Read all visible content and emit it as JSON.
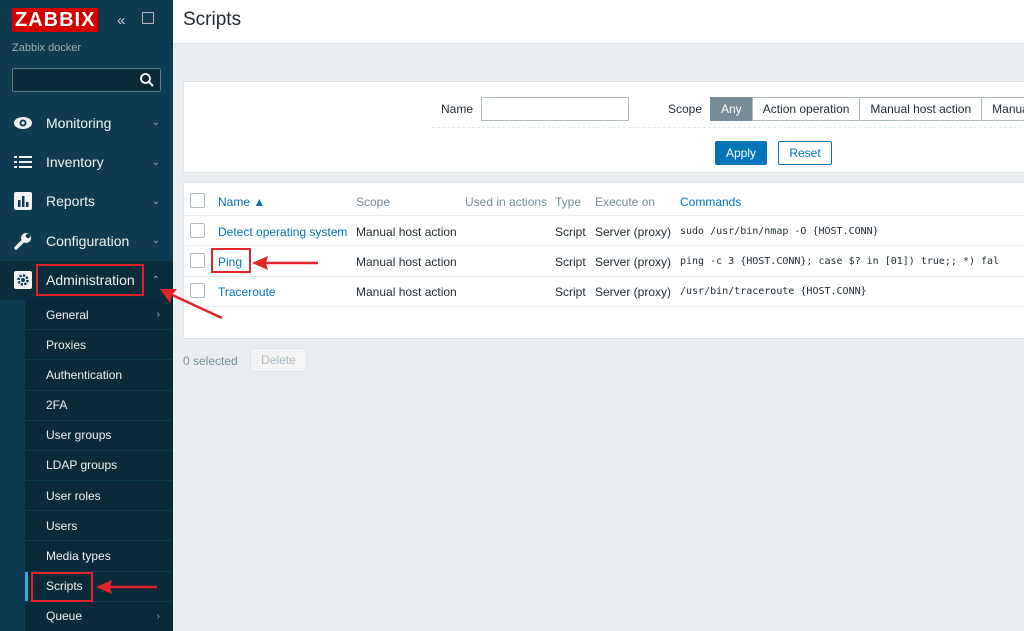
{
  "brand": {
    "logo": "ZABBIX",
    "server_name": "Zabbix docker"
  },
  "sidebar": {
    "collapse_icon": "double-chevron-left-icon",
    "kiosk_icon": "expand-icon",
    "menu": [
      {
        "label": "Monitoring",
        "icon": "eye-icon"
      },
      {
        "label": "Inventory",
        "icon": "list-icon"
      },
      {
        "label": "Reports",
        "icon": "bar-chart-icon"
      },
      {
        "label": "Configuration",
        "icon": "wrench-icon"
      },
      {
        "label": "Administration",
        "icon": "gear-icon"
      }
    ],
    "admin_submenu": [
      "General",
      "Proxies",
      "Authentication",
      "2FA",
      "User groups",
      "LDAP groups",
      "User roles",
      "Users",
      "Media types",
      "Scripts",
      "Queue"
    ]
  },
  "header": {
    "title": "Scripts"
  },
  "filter": {
    "name_label": "Name",
    "name_value": "",
    "scope_label": "Scope",
    "scope_options": [
      "Any",
      "Action operation",
      "Manual host action",
      "Manua"
    ],
    "scope_selected": "Any",
    "apply": "Apply",
    "reset": "Reset"
  },
  "table": {
    "columns": [
      "Name ▲",
      "Scope",
      "Used in actions",
      "Type",
      "Execute on",
      "Commands"
    ],
    "rows": [
      {
        "name": "Detect operating system",
        "scope": "Manual host action",
        "used": "",
        "type": "Script",
        "execute_on": "Server (proxy)",
        "command": "sudo /usr/bin/nmap -O {HOST.CONN}"
      },
      {
        "name": "Ping",
        "scope": "Manual host action",
        "used": "",
        "type": "Script",
        "execute_on": "Server (proxy)",
        "command": "ping -c 3 {HOST.CONN}; case $? in [01]) true;; *) fal"
      },
      {
        "name": "Traceroute",
        "scope": "Manual host action",
        "used": "",
        "type": "Script",
        "execute_on": "Server (proxy)",
        "command": "/usr/bin/traceroute {HOST.CONN}"
      }
    ]
  },
  "footer": {
    "selected": "0 selected",
    "delete": "Delete"
  },
  "colors": {
    "sidebar": "#0e3b50",
    "accent": "#0275b8",
    "logo": "#d40000",
    "annotation": "#e0242a"
  }
}
